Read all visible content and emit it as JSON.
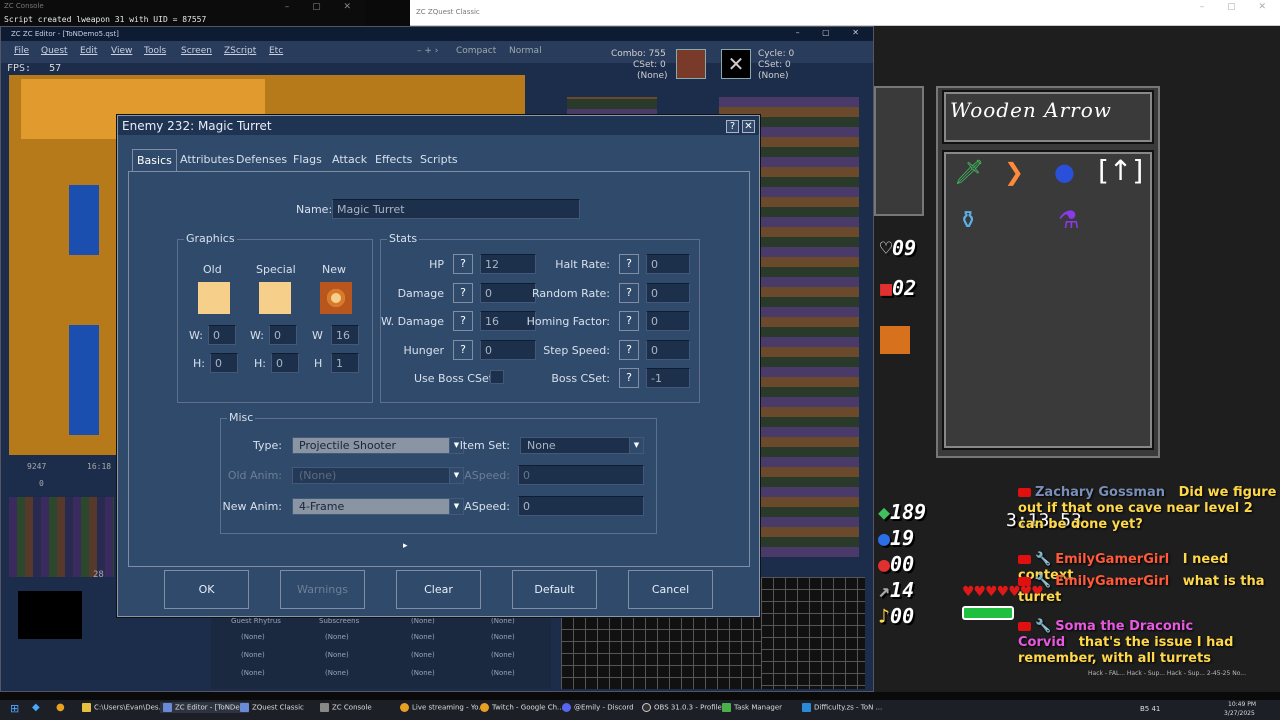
{
  "console": {
    "title": "ZC Console",
    "log_line": "Script created lweapon 31 with UID = 87557"
  },
  "zqc_window": {
    "title": "ZC ZQuest Classic"
  },
  "editor": {
    "title": "ZC ZC Editor - [ToNDemo5.qst]",
    "menus": [
      "File",
      "Quest",
      "Edit",
      "View",
      "Tools",
      "Screen",
      "ZScript",
      "Etc"
    ],
    "toolbar": {
      "compact": "Compact",
      "normal": "Normal"
    },
    "fps_label": "FPS:",
    "fps_value": "57",
    "combo_panel": {
      "combo": "Combo: 755",
      "cset": "CSet: 0",
      "none": "(None)",
      "cycle": "Cycle: 0",
      "cset2": "CSet: 0",
      "none2": "(None)"
    },
    "coords_left": "9247",
    "coords_right": "16:18",
    "coord_zero": "0",
    "num_28": "28",
    "bottom_table": {
      "headers": [
        "Guest Rhytrus",
        "Subscreens",
        "(None)",
        "(None)"
      ],
      "cell": "(None)"
    }
  },
  "dialog": {
    "title": "Enemy 232: Magic Turret",
    "help": "?",
    "close": "✕",
    "tabs": [
      "Basics",
      "Attributes",
      "Defenses",
      "Flags",
      "Attack",
      "Effects",
      "Scripts"
    ],
    "name_label": "Name:",
    "name_value": "Magic Turret",
    "graphics": {
      "title": "Graphics",
      "old": "Old",
      "special": "Special",
      "new": "New",
      "w_label": "W:",
      "h_label": "H:",
      "w_new_label": "W",
      "h_new_label": "H",
      "old_w": "0",
      "old_h": "0",
      "special_w": "0",
      "special_h": "0",
      "new_w": "16",
      "new_h": "1"
    },
    "stats": {
      "title": "Stats",
      "hp_label": "HP",
      "hp": "12",
      "damage_label": "Damage",
      "damage": "0",
      "wdamage_label": "W. Damage",
      "wdamage": "16",
      "hunger_label": "Hunger",
      "hunger": "0",
      "use_boss_cset_label": "Use Boss CSet",
      "halt_rate_label": "Halt Rate:",
      "halt_rate": "0",
      "random_rate_label": "Random Rate:",
      "random_rate": "0",
      "homing_label": "Homing Factor:",
      "homing": "0",
      "step_speed_label": "Step Speed:",
      "step_speed": "0",
      "boss_cset_label": "Boss CSet:",
      "boss_cset": "-1"
    },
    "misc": {
      "title": "Misc",
      "type_label": "Type:",
      "type_value": "Projectile Shooter",
      "item_set_label": "Item Set:",
      "item_set_value": "None",
      "old_anim_label": "Old Anim:",
      "old_anim_value": "(None)",
      "aspeed_label": "ASpeed:",
      "aspeed_old": "0",
      "new_anim_label": "New Anim:",
      "new_anim_value": "4-Frame",
      "aspeed_label2": "ASpeed:",
      "aspeed_new": "0"
    },
    "buttons": {
      "ok": "OK",
      "warnings": "Warnings",
      "clear": "Clear",
      "default": "Default",
      "cancel": "Cancel"
    }
  },
  "game": {
    "weapon_name": "Wooden Arrow",
    "counter_1": "09",
    "counter_2": "02",
    "rupees": "189",
    "bombs": "19",
    "arrows": "00",
    "keys_a": "14",
    "keys_b": "00",
    "timer": "3:13.53",
    "hearts": "♥♥♥♥♥♥♥"
  },
  "chat": [
    {
      "name": "Zachary Gossman",
      "msg": "Did we figure out if that one cave near level 2 can be done yet?"
    },
    {
      "name": "EmilyGamerGirl",
      "msg": "I need context"
    },
    {
      "name": "EmilyGamerGirl",
      "msg": "what is tha turret"
    },
    {
      "name": "Soma the Draconic Corvid",
      "msg": "that's the issue I had remember, with all turrets"
    }
  ],
  "stream_footer": "Hack - FAL...  Hack - Sup...  Hack - Sup...  2-45-25 No...",
  "taskbar": {
    "items": [
      "C:\\Users\\Evan\\Des...",
      "ZC Editor - [ToNDe...",
      "ZQuest Classic",
      "ZC Console",
      "Live streaming - Yo...",
      "Twitch - Google Ch...",
      "@Emily - Discord",
      "OBS 31.0.3 - Profile...",
      "Task Manager",
      "Difficulty.zs - ToN ..."
    ],
    "tray": "B5  41",
    "time": "10:49 PM",
    "date": "3/27/2025"
  },
  "colors": {
    "dialog_bg": "#2f4a6b",
    "field_bg": "#1c2f4b",
    "swatch": "#f6cf8a",
    "chat_msg": "#ffd84a",
    "yt_red": "#e01010"
  }
}
